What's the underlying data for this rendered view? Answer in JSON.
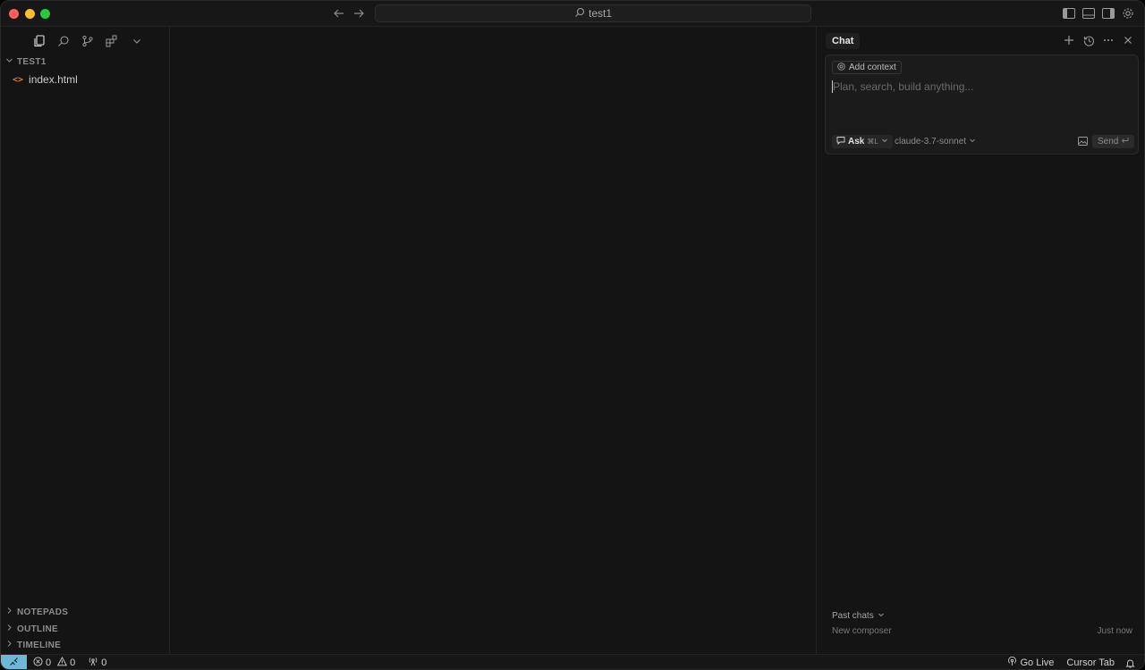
{
  "titlebar": {
    "search_text": "test1"
  },
  "sidebar": {
    "workspace_title": "TEST1",
    "files": [
      {
        "name": "index.html",
        "icon": "html-file-icon"
      }
    ],
    "bottom_sections": [
      {
        "label": "NOTEPADS"
      },
      {
        "label": "OUTLINE"
      },
      {
        "label": "TIMELINE"
      }
    ]
  },
  "chat": {
    "tab_label": "Chat",
    "add_context_label": "Add context",
    "input_placeholder": "Plan, search, build anything...",
    "mode_label": "Ask",
    "mode_shortcut": "⌘L",
    "model_label": "claude-3.7-sonnet",
    "send_label": "Send",
    "past_chats_label": "Past chats",
    "history": [
      {
        "title": "New composer",
        "time": "Just now"
      }
    ]
  },
  "statusbar": {
    "errors": "0",
    "warnings": "0",
    "ports": "0",
    "go_live_label": "Go Live",
    "cursor_tab_label": "Cursor Tab"
  },
  "colors": {
    "window_bg": "#141414",
    "remote_accent": "#6fb7d6",
    "html_icon": "#e37933"
  }
}
